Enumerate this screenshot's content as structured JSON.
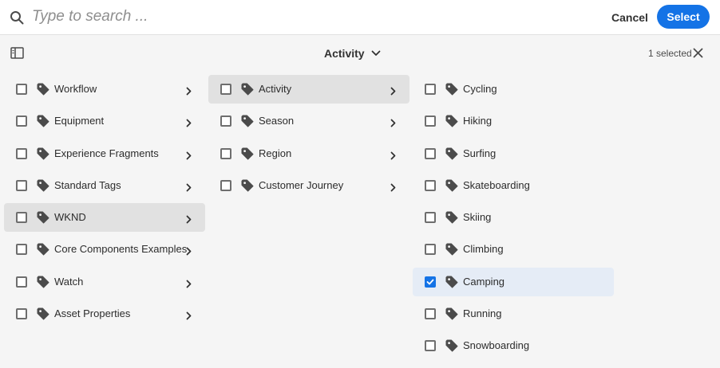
{
  "search": {
    "placeholder": "Type to search ..."
  },
  "header": {
    "cancel_label": "Cancel",
    "select_label": "Select"
  },
  "toolbar": {
    "breadcrumb": "Activity",
    "selected_count": "1 selected"
  },
  "columns": [
    {
      "items": [
        {
          "label": "Workflow",
          "has_children": true
        },
        {
          "label": "Equipment",
          "has_children": true
        },
        {
          "label": "Experience Fragments",
          "has_children": true
        },
        {
          "label": "Standard Tags",
          "has_children": true
        },
        {
          "label": "WKND",
          "has_children": true,
          "active": true
        },
        {
          "label": "Core Components Examples",
          "has_children": true
        },
        {
          "label": "Watch",
          "has_children": true
        },
        {
          "label": "Asset Properties",
          "has_children": true
        }
      ]
    },
    {
      "items": [
        {
          "label": "Activity",
          "has_children": true,
          "active": true
        },
        {
          "label": "Season",
          "has_children": true
        },
        {
          "label": "Region",
          "has_children": true
        },
        {
          "label": "Customer Journey",
          "has_children": true
        }
      ]
    },
    {
      "items": [
        {
          "label": "Cycling"
        },
        {
          "label": "Hiking"
        },
        {
          "label": "Surfing"
        },
        {
          "label": "Skateboarding"
        },
        {
          "label": "Skiing"
        },
        {
          "label": "Climbing"
        },
        {
          "label": "Camping",
          "checked": true
        },
        {
          "label": "Running"
        },
        {
          "label": "Snowboarding"
        }
      ]
    }
  ],
  "colors": {
    "accent": "#1473e6",
    "active_row": "#e1e1e1",
    "checked_row": "#e5ecf6"
  }
}
